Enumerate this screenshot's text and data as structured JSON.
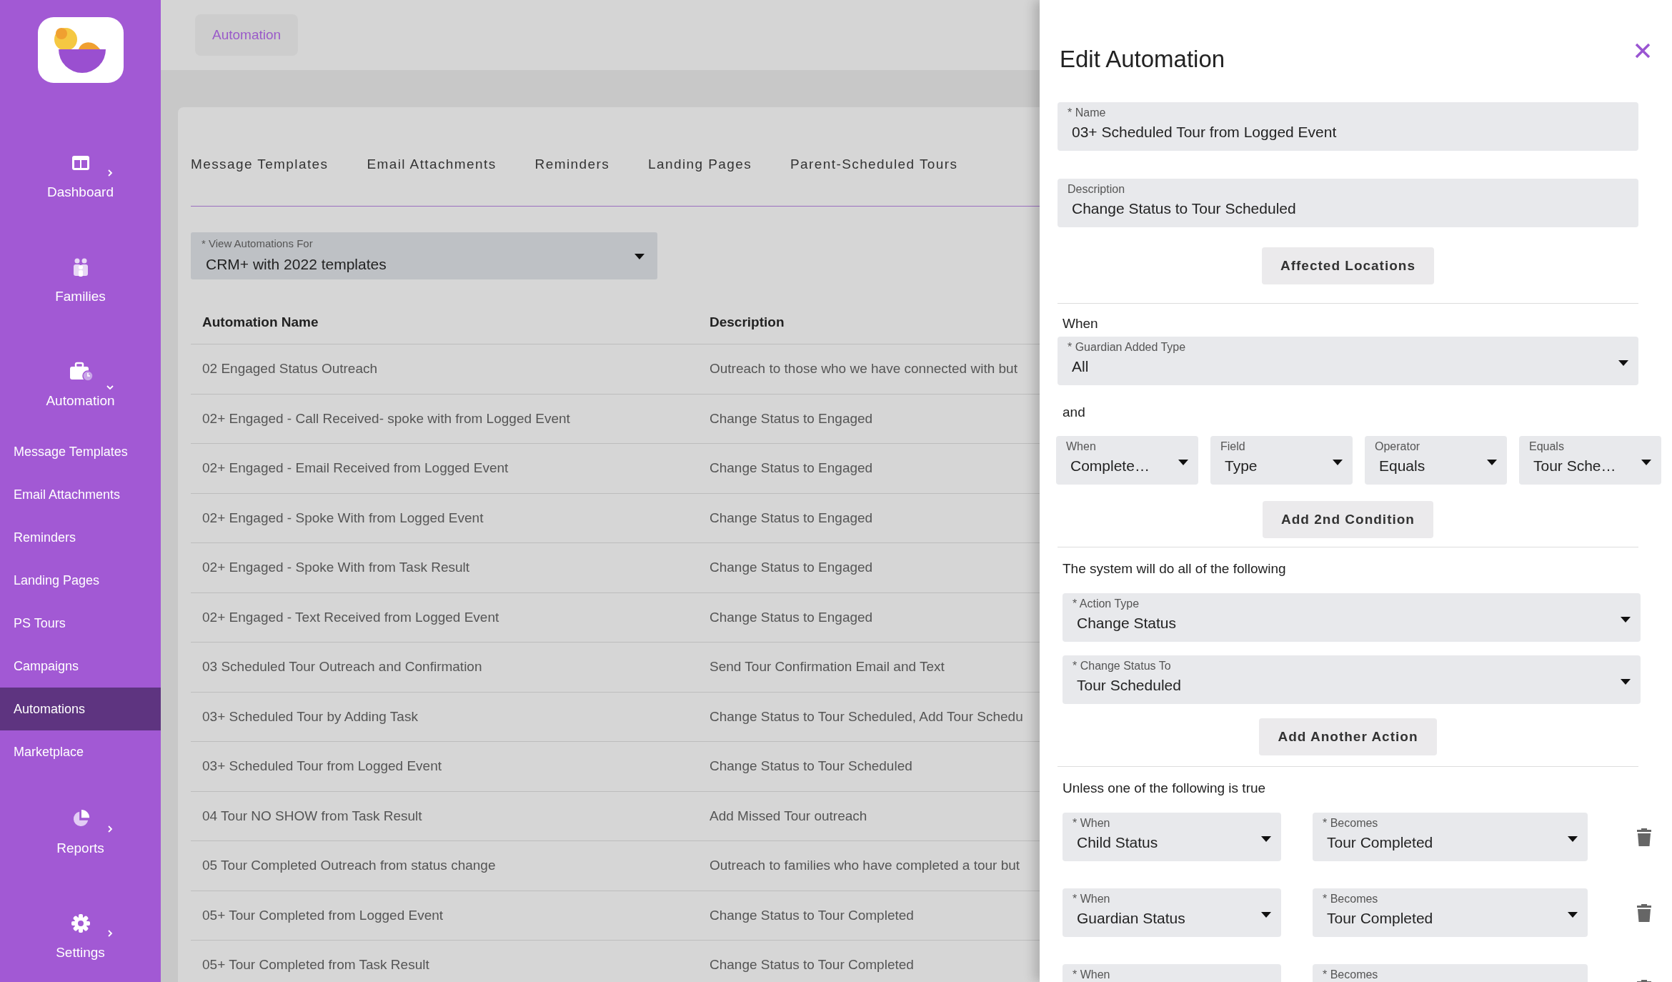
{
  "sidebar": {
    "items": [
      {
        "label": "Dashboard",
        "expanded": false
      },
      {
        "label": "Families"
      },
      {
        "label": "Automation",
        "expanded": true,
        "children": [
          {
            "label": "Message Templates",
            "selected": false
          },
          {
            "label": "Email Attachments",
            "selected": false
          },
          {
            "label": "Reminders",
            "selected": false
          },
          {
            "label": "Landing Pages",
            "selected": false
          },
          {
            "label": "PS Tours",
            "selected": false
          },
          {
            "label": "Campaigns",
            "selected": false
          },
          {
            "label": "Automations",
            "selected": true
          },
          {
            "label": "Marketplace",
            "selected": false
          }
        ]
      },
      {
        "label": "Reports",
        "expanded": false
      },
      {
        "label": "Settings",
        "expanded": false
      }
    ]
  },
  "header": {
    "breadcrumb": "Automation"
  },
  "tabs": [
    {
      "label": "Message Templates",
      "selected": false
    },
    {
      "label": "Email Attachments",
      "selected": false
    },
    {
      "label": "Reminders",
      "selected": false
    },
    {
      "label": "Landing Pages",
      "selected": false
    },
    {
      "label": "Parent-Scheduled Tours",
      "selected": false
    }
  ],
  "view_select": {
    "label": "* View Automations For",
    "value": "CRM+ with 2022 templates"
  },
  "table": {
    "columns": [
      "Automation Name",
      "Description"
    ],
    "rows": [
      [
        "02 Engaged Status Outreach",
        "Outreach to those who we have connected with but"
      ],
      [
        "02+ Engaged - Call Received- spoke with from Logged Event",
        "Change Status to Engaged"
      ],
      [
        "02+ Engaged - Email Received from Logged Event",
        "Change Status to Engaged"
      ],
      [
        "02+ Engaged - Spoke With from Logged Event",
        "Change Status to Engaged"
      ],
      [
        "02+ Engaged - Spoke With from Task Result",
        "Change Status to Engaged"
      ],
      [
        "02+ Engaged - Text Received from Logged Event",
        "Change Status to Engaged"
      ],
      [
        "03 Scheduled Tour Outreach and Confirmation",
        "Send Tour Confirmation Email and Text"
      ],
      [
        "03+ Scheduled Tour by Adding Task",
        "Change Status to Tour Scheduled, Add Tour Schedu"
      ],
      [
        "03+ Scheduled Tour from Logged Event",
        "Change Status to Tour Scheduled"
      ],
      [
        "04 Tour NO SHOW from Task Result",
        "Add Missed Tour outreach"
      ],
      [
        "05 Tour Completed Outreach from status change",
        "Outreach to families who have completed a tour but"
      ],
      [
        "05+ Tour Completed from Logged Event",
        "Change Status to Tour Completed"
      ],
      [
        "05+ Tour Completed from Task Result",
        "Change Status to Tour Completed"
      ]
    ]
  },
  "panel": {
    "title": "Edit Automation",
    "name_field": {
      "label": "* Name",
      "value": "03+ Scheduled Tour from Logged Event"
    },
    "description_field": {
      "label": "Description",
      "value": "Change Status to Tour Scheduled"
    },
    "affected_button": "Affected Locations",
    "when_label": "When",
    "guardian_select": {
      "label": "* Guardian Added Type",
      "value": "All"
    },
    "and_label": "and",
    "conditions": [
      {
        "label": "When",
        "value": "Complete…"
      },
      {
        "label": "Field",
        "value": "Type"
      },
      {
        "label": "Operator",
        "value": "Equals"
      },
      {
        "label": "Equals",
        "value": "Tour Sche…"
      }
    ],
    "add_condition_button": "Add 2nd Condition",
    "actions_label": "The system will do all of the following",
    "actions": [
      {
        "label": "* Action Type",
        "value": "Change Status"
      },
      {
        "label": "* Change Status To",
        "value": "Tour Scheduled"
      }
    ],
    "add_action_button": "Add Another Action",
    "unless_label": "Unless one of the following is true",
    "unless_rows": [
      {
        "when": {
          "label": "* When",
          "value": "Child Status"
        },
        "becomes": {
          "label": "* Becomes",
          "value": "Tour Completed"
        }
      },
      {
        "when": {
          "label": "* When",
          "value": "Guardian Status"
        },
        "becomes": {
          "label": "* Becomes",
          "value": "Tour Completed"
        }
      },
      {
        "when": {
          "label": "* When"
        },
        "becomes": {
          "label": "* Becomes"
        }
      }
    ]
  }
}
